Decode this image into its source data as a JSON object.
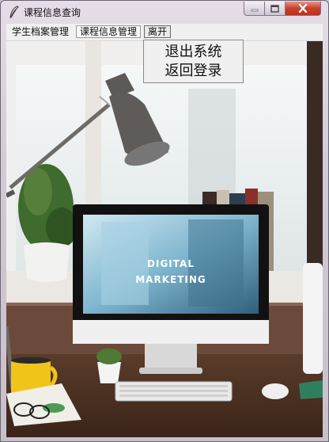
{
  "window": {
    "title": "课程信息查询"
  },
  "menubar": {
    "items": [
      {
        "label": "学生档案管理"
      },
      {
        "label": "课程信息管理"
      },
      {
        "label": "离开"
      }
    ]
  },
  "dropdown": {
    "items": [
      {
        "label": "退出系统"
      },
      {
        "label": "返回登录"
      }
    ]
  },
  "photo": {
    "screen_text_line1": "DIGITAL",
    "screen_text_line2": "MARKETING"
  },
  "colors": {
    "close_button": "#c9402c",
    "menu_bg": "#f0f0f0"
  }
}
